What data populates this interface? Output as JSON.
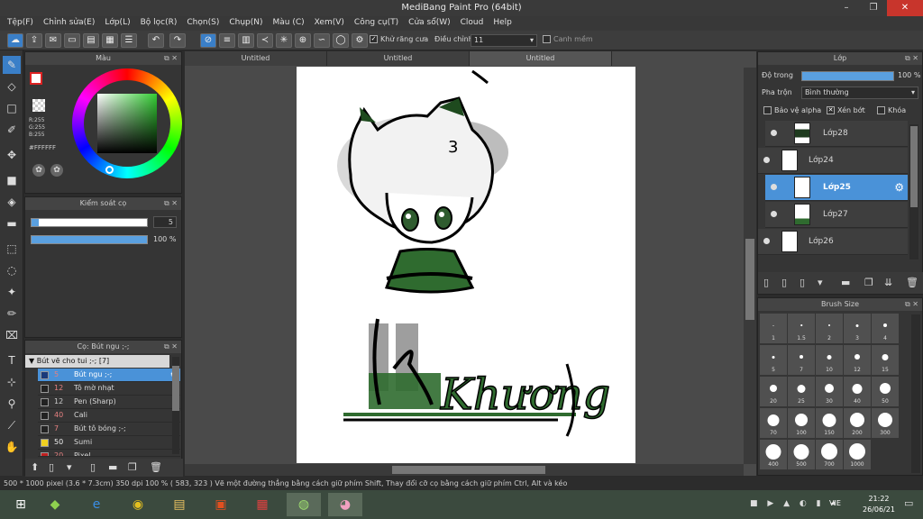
{
  "window": {
    "title": "MediBang Paint Pro (64bit)",
    "min": "–",
    "max": "❐",
    "close": "✕"
  },
  "menu": [
    "Tệp(F)",
    "Chỉnh sửa(E)",
    "Lớp(L)",
    "Bộ lọc(R)",
    "Chọn(S)",
    "Chụp(N)",
    "Màu (C)",
    "Xem(V)",
    "Công cụ(T)",
    "Cửa sổ(W)",
    "Cloud",
    "Help"
  ],
  "toolbar": {
    "antialias_label": "Khử răng cưa",
    "adjust_label": "Điều chỉnh",
    "adjust_value": "11",
    "smooth_label": "Canh mềm"
  },
  "color_panel": {
    "title": "Màu",
    "r": "R:255",
    "g": "G:255",
    "b": "B:255",
    "hex": "#FFFFFF"
  },
  "brush_control": {
    "title": "Kiểm soát cọ",
    "size": "5",
    "opacity": "100 %"
  },
  "brush_panel": {
    "title": "Cọ: Bút ngu ;-;",
    "group": "Bút vẽ cho tui ;-; [7]",
    "items": [
      {
        "size": "5",
        "name": "Bút ngu ;-;",
        "color": "#1a3a7a"
      },
      {
        "size": "12",
        "name": "Tô mờ nhạt",
        "color": "#222222"
      },
      {
        "size": "12",
        "name": "Pen (Sharp)",
        "color": "#222222"
      },
      {
        "size": "40",
        "name": "Cali",
        "color": "#222222"
      },
      {
        "size": "7",
        "name": "Bút tô bóng ;-;",
        "color": "#222222"
      },
      {
        "size": "50",
        "name": "Sumi",
        "color": "#f0d020"
      },
      {
        "size": "20",
        "name": "Pixel",
        "color": "#c02020"
      }
    ]
  },
  "documents": {
    "tabs": [
      "Untitled",
      "Untitled",
      "Untitled"
    ]
  },
  "layer_panel": {
    "title": "Lớp",
    "opacity_label": "Độ trong",
    "opacity_value": "100 %",
    "blend_label": "Pha trộn",
    "blend_value": "Bình thường",
    "protect_alpha": "Bảo vệ alpha",
    "clipping": "Xén bớt",
    "lock": "Khóa",
    "layers": [
      "Lớp28",
      "Lớp24",
      "Lớp25",
      "Lớp27",
      "Lớp26"
    ]
  },
  "brush_size": {
    "title": "Brush Size",
    "sizes": [
      "1",
      "1.5",
      "2",
      "3",
      "4",
      "5",
      "7",
      "10",
      "12",
      "15",
      "20",
      "25",
      "30",
      "40",
      "50",
      "70",
      "100",
      "150",
      "200",
      "300",
      "400",
      "500",
      "700",
      "1000"
    ]
  },
  "canvas_text": "Khương",
  "status": {
    "text": "500 * 1000 pixel  (3.6 * 7.3cm)  350 dpi  100 %  ( 583, 323 )  Vẽ một đường thẳng bằng cách giữ phím Shift, Thay đổi cỡ cọ bằng cách giữ phím Ctrl, Alt và kéo"
  },
  "taskbar": {
    "lang": "VIE",
    "time": "21:22",
    "date": "26/06/21"
  }
}
